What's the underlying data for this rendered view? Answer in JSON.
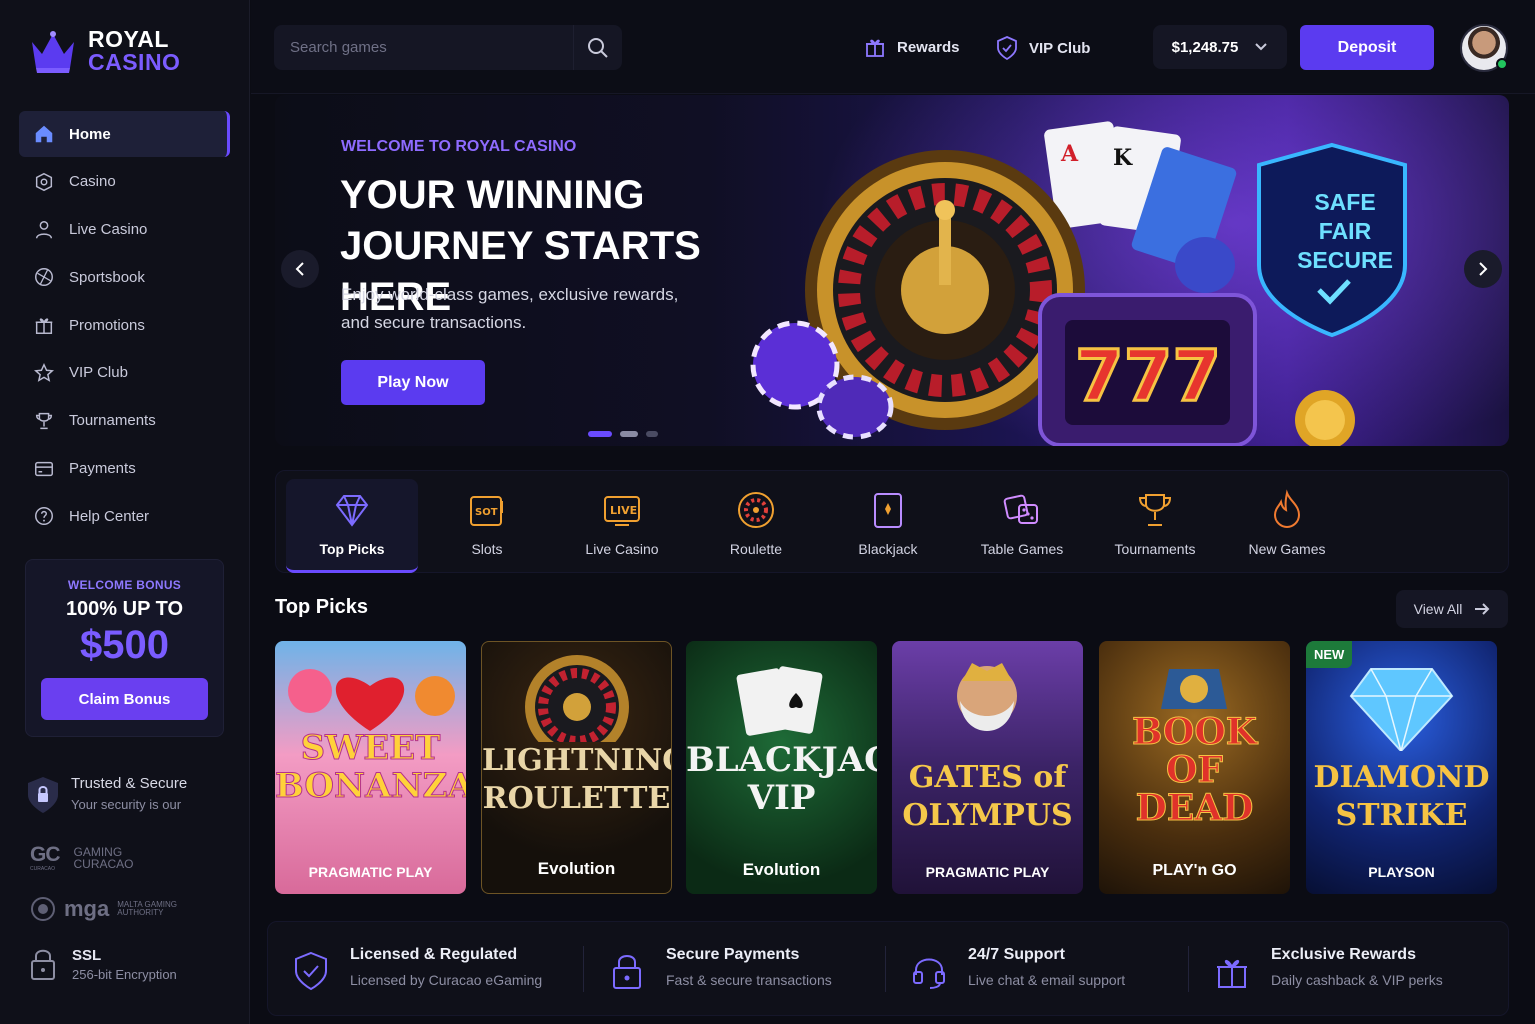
{
  "brand": {
    "line1": "ROYAL",
    "line2": "CASINO"
  },
  "sidebar": {
    "items": [
      {
        "label": "Home",
        "icon": "home-icon",
        "active": true
      },
      {
        "label": "Casino",
        "icon": "casino-chip-icon"
      },
      {
        "label": "Live Casino",
        "icon": "dealer-icon"
      },
      {
        "label": "Sportsbook",
        "icon": "ball-icon"
      },
      {
        "label": "Promotions",
        "icon": "gift-icon"
      },
      {
        "label": "VIP Club",
        "icon": "star-icon"
      },
      {
        "label": "Tournaments",
        "icon": "trophy-icon"
      },
      {
        "label": "Payments",
        "icon": "card-icon"
      },
      {
        "label": "Help Center",
        "icon": "help-icon"
      }
    ],
    "bonus": {
      "kicker": "WELCOME BONUS",
      "title": "100% UP TO",
      "amount": "$500",
      "button": "Claim Bonus"
    },
    "trust": {
      "title": "Trusted & Secure",
      "subtitle": "Your security is our"
    },
    "gc": {
      "mark": "GC",
      "sub_mark": "CURACAO",
      "text1": "GAMING",
      "text2": "CURACAO"
    },
    "mga": {
      "name": "mga",
      "text1": "MALTA GAMING",
      "text2": "AUTHORITY"
    },
    "ssl": {
      "title": "SSL",
      "subtitle": "256-bit Encryption"
    }
  },
  "topbar": {
    "search_placeholder": "Search games",
    "rewards": "Rewards",
    "vip": "VIP Club",
    "balance": "$1,248.75",
    "deposit": "Deposit"
  },
  "hero": {
    "kicker": "WELCOME TO ROYAL CASINO",
    "title_line1": "YOUR WINNING",
    "title_line2": "JOURNEY STARTS HERE",
    "desc_line1": "Enjoy world-class games, exclusive rewards,",
    "desc_line2": "and secure transactions.",
    "button": "Play Now",
    "shield": {
      "l1": "SAFE",
      "l2": "FAIR",
      "l3": "SECURE"
    },
    "slot_digits": "777"
  },
  "categories": [
    {
      "label": "Top Picks",
      "icon": "diamond-icon",
      "active": true
    },
    {
      "label": "Slots",
      "icon": "slot-machine-icon"
    },
    {
      "label": "Live Casino",
      "icon": "live-icon"
    },
    {
      "label": "Roulette",
      "icon": "roulette-icon"
    },
    {
      "label": "Blackjack",
      "icon": "card-icon"
    },
    {
      "label": "Table Games",
      "icon": "dice-icon"
    },
    {
      "label": "Tournaments",
      "icon": "trophy-icon"
    },
    {
      "label": "New Games",
      "icon": "flame-icon"
    }
  ],
  "category_icon_text": {
    "slots": "SOT",
    "live": "LIVE"
  },
  "top_picks": {
    "title": "Top Picks",
    "view_all": "View All",
    "games": [
      {
        "title1": "SWEET",
        "title2": "BONANZA",
        "provider": "PRAGMATIC PLAY",
        "badge": ""
      },
      {
        "title1": "LIGHTNING",
        "title2": "ROULETTE",
        "provider": "Evolution",
        "badge": ""
      },
      {
        "title1": "BLACKJACK",
        "title2": "VIP",
        "provider": "Evolution",
        "badge": ""
      },
      {
        "title1": "GATES of",
        "title2": "OLYMPUS",
        "provider": "PRAGMATIC PLAY",
        "badge": ""
      },
      {
        "title1": "BOOK OF",
        "title2": "DEAD",
        "provider": "PLAY'n GO",
        "badge": ""
      },
      {
        "title1": "DIAMOND",
        "title2": "STRIKE",
        "provider": "PLAYSON",
        "badge": "NEW"
      }
    ]
  },
  "features": [
    {
      "title": "Licensed & Regulated",
      "subtitle": "Licensed by Curacao eGaming",
      "icon": "shield-check-icon"
    },
    {
      "title": "Secure Payments",
      "subtitle": "Fast & secure transactions",
      "icon": "lock-icon"
    },
    {
      "title": "24/7 Support",
      "subtitle": "Live chat & email support",
      "icon": "headset-icon"
    },
    {
      "title": "Exclusive Rewards",
      "subtitle": "Daily cashback & VIP perks",
      "icon": "gift-icon"
    }
  ],
  "colors": {
    "accent": "#6a4bff",
    "button": "#5b3bf0",
    "bg": "#0b0c14",
    "panel": "#0f1019"
  }
}
